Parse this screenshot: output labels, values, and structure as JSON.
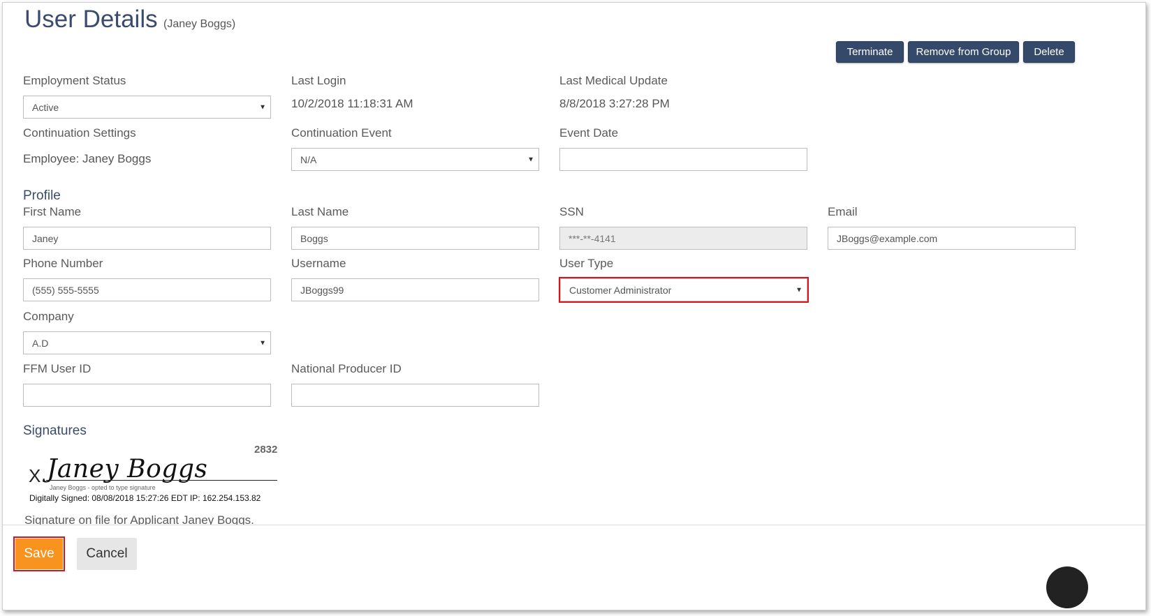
{
  "header": {
    "title": "User Details",
    "subtitle": "(Janey Boggs)"
  },
  "actions": {
    "terminate": "Terminate",
    "remove_from_group": "Remove from Group",
    "delete": "Delete"
  },
  "status": {
    "employment_status_label": "Employment Status",
    "employment_status_value": "Active",
    "last_login_label": "Last Login",
    "last_login_value": "10/2/2018 11:18:31 AM",
    "last_medical_update_label": "Last Medical Update",
    "last_medical_update_value": "8/8/2018 3:27:28 PM",
    "continuation_settings_label": "Continuation Settings",
    "continuation_settings_value": "Employee: Janey Boggs",
    "continuation_event_label": "Continuation Event",
    "continuation_event_value": "N/A",
    "event_date_label": "Event Date",
    "event_date_value": ""
  },
  "profile": {
    "section_title": "Profile",
    "first_name_label": "First Name",
    "first_name_value": "Janey",
    "last_name_label": "Last Name",
    "last_name_value": "Boggs",
    "ssn_label": "SSN",
    "ssn_value": "***-**-4141",
    "email_label": "Email",
    "email_value": "JBoggs@example.com",
    "phone_label": "Phone Number",
    "phone_value": "(555) 555-5555",
    "username_label": "Username",
    "username_value": "JBoggs99",
    "user_type_label": "User Type",
    "user_type_value": "Customer Administrator",
    "company_label": "Company",
    "company_value": "A.D",
    "ffm_user_id_label": "FFM User ID",
    "ffm_user_id_value": "",
    "national_producer_id_label": "National Producer ID",
    "national_producer_id_value": ""
  },
  "signatures": {
    "section_title": "Signatures",
    "number": "2832",
    "x_mark": "X",
    "signature_name": "Janey Boggs",
    "caption": "Janey Boggs - opted to type signature",
    "digital_meta": "Digitally Signed: 08/08/2018 15:27:26 EDT IP: 162.254.153.82",
    "on_file_text": "Signature on file for Applicant Janey Boggs."
  },
  "footer": {
    "save": "Save",
    "cancel": "Cancel"
  },
  "colors": {
    "primary_button": "#354a6b",
    "save_button": "#f7931e",
    "highlight": "#d9141a",
    "title": "#3b4b6e"
  }
}
